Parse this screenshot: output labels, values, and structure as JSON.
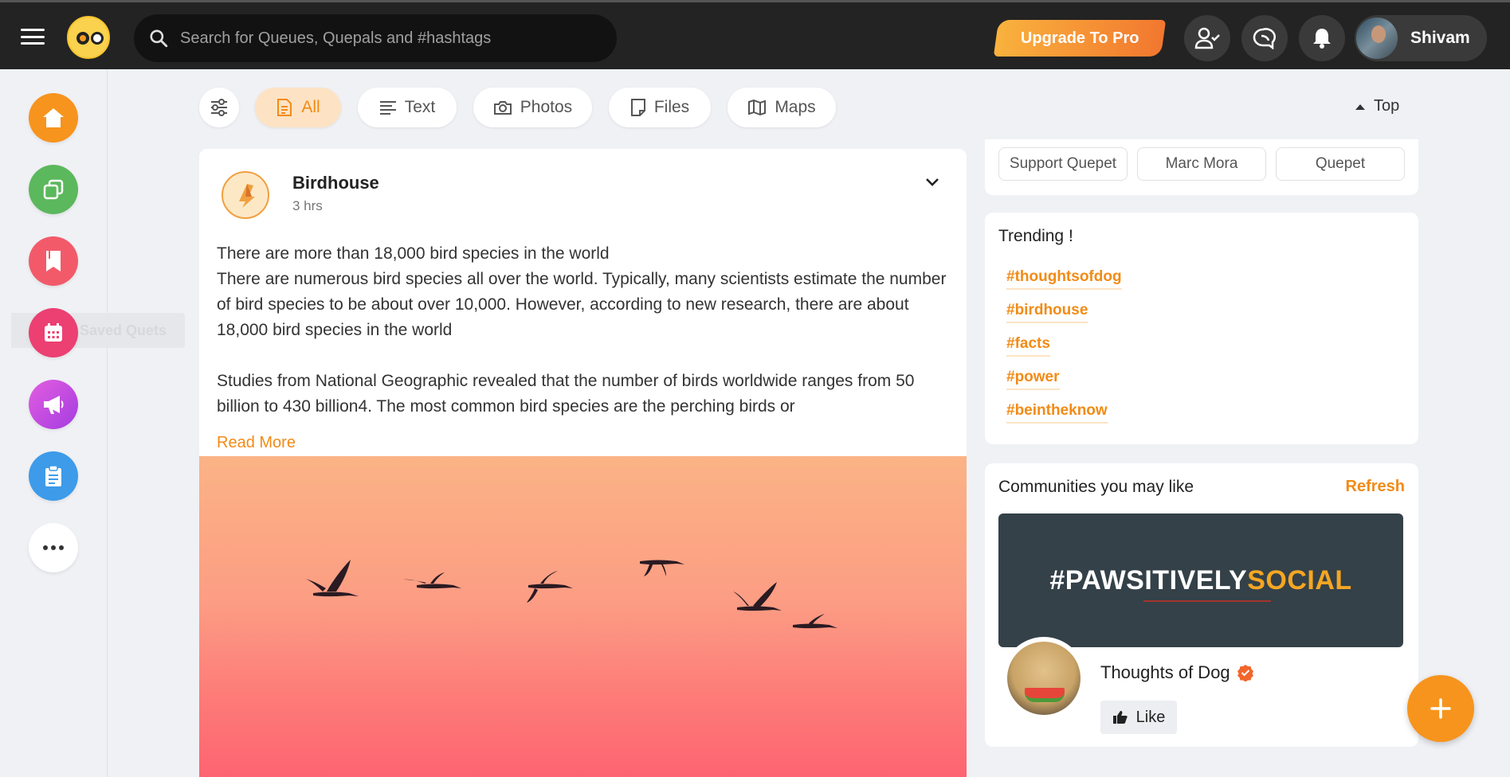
{
  "header": {
    "search_placeholder": "Search for Queues, Quepals and #hashtags",
    "upgrade_label": "Upgrade To Pro",
    "user_name": "Shivam"
  },
  "sidebar": {
    "tooltip": "Saved Quets",
    "items": [
      {
        "icon": "home-icon",
        "color": "#f7941d"
      },
      {
        "icon": "stack-icon",
        "color": "#5cb85c"
      },
      {
        "icon": "bookmark-icon",
        "color": "#f25a6a"
      },
      {
        "icon": "calendar-icon",
        "color": "#ec3f72"
      },
      {
        "icon": "megaphone-icon",
        "color": "#c94de0"
      },
      {
        "icon": "clipboard-icon",
        "color": "#3d9be9"
      },
      {
        "icon": "more-icon",
        "color": "#ffffff"
      }
    ]
  },
  "filters": {
    "chips": [
      {
        "label": "All",
        "icon": "document-icon",
        "active": true
      },
      {
        "label": "Text",
        "icon": "text-lines-icon",
        "active": false
      },
      {
        "label": "Photos",
        "icon": "camera-icon",
        "active": false
      },
      {
        "label": "Files",
        "icon": "file-icon",
        "active": false
      },
      {
        "label": "Maps",
        "icon": "map-icon",
        "active": false
      }
    ],
    "top_label": "Top"
  },
  "post": {
    "author": "Birdhouse",
    "time": "3 hrs",
    "heading": "There are more than 18,000 bird species in the world",
    "para1": "There are numerous bird species all over the world. Typically, many scientists estimate the number of bird species to be about over 10,000. However, according to new research, there are about 18,000 bird species in the world",
    "para2": "Studies from National Geographic revealed that the number of birds worldwide ranges from 50 billion to 430 billion4. The most common bird species are the perching birds or",
    "read_more": "Read More"
  },
  "support": {
    "pills": [
      "Support Quepet",
      "Marc Mora",
      "Quepet"
    ]
  },
  "trending": {
    "title": "Trending !",
    "tags": [
      "#thoughtsofdog",
      "#birdhouse",
      "#facts",
      "#power",
      "#beintheknow"
    ]
  },
  "communities": {
    "title": "Communities you may like",
    "refresh": "Refresh",
    "banner_part1": "#PAWSITIVELY",
    "banner_part2": "SOCIAL",
    "community_name": "Thoughts of Dog",
    "like_label": "Like"
  },
  "colors": {
    "accent": "#f28b16",
    "topbar": "#232323"
  }
}
